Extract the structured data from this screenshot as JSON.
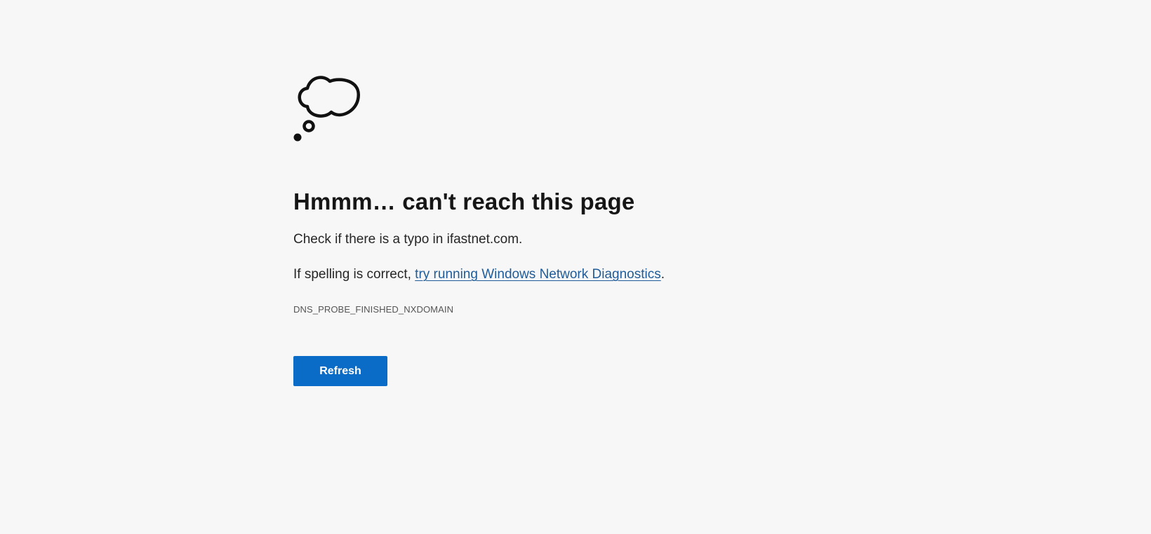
{
  "error": {
    "icon": "thought-cloud-icon",
    "title": "Hmmm… can't reach this page",
    "typo_message": "Check if there is a typo in ifastnet.com.",
    "spelling_prefix": "If spelling is correct, ",
    "diagnostics_link": "try running Windows Network Diagnostics",
    "spelling_suffix": ".",
    "code": "DNS_PROBE_FINISHED_NXDOMAIN",
    "refresh_label": "Refresh"
  },
  "colors": {
    "background": "#f7f7f7",
    "link": "#1f5c99",
    "button": "#0a6cc6"
  }
}
